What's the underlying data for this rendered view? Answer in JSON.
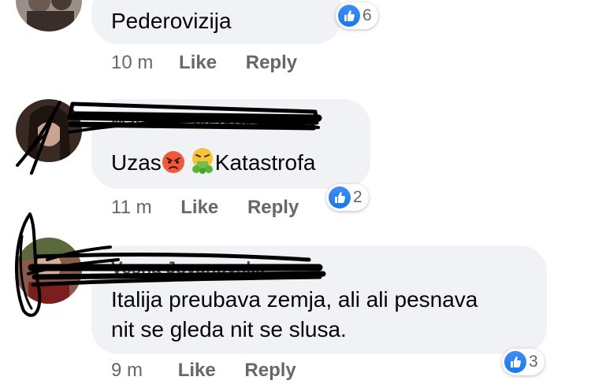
{
  "comments": [
    {
      "author": "",
      "text": "Pederovizija",
      "time": "10 m",
      "like_label": "Like",
      "reply_label": "Reply",
      "reaction_count": "6"
    },
    {
      "author": "Marinela Svetkovska",
      "text_before": "Uzas",
      "text_after": "Katastrofa",
      "emoji_1": "angry-face",
      "emoji_2": "vomiting-face",
      "time": "11 m",
      "like_label": "Like",
      "reply_label": "Reply",
      "reaction_count": "2"
    },
    {
      "author": "Vesna Jovanovska",
      "text_line1": "Italija preubava zemja, ali ali pesnava",
      "text_line2": "nit se gleda nit se slusa.",
      "time": "9 m",
      "like_label": "Like",
      "reply_label": "Reply",
      "reaction_count": "3"
    }
  ],
  "colors": {
    "bubble": "#f0f2f5",
    "meta": "#65676b",
    "like_blue": "#1877f2",
    "scribble": "#000000"
  }
}
